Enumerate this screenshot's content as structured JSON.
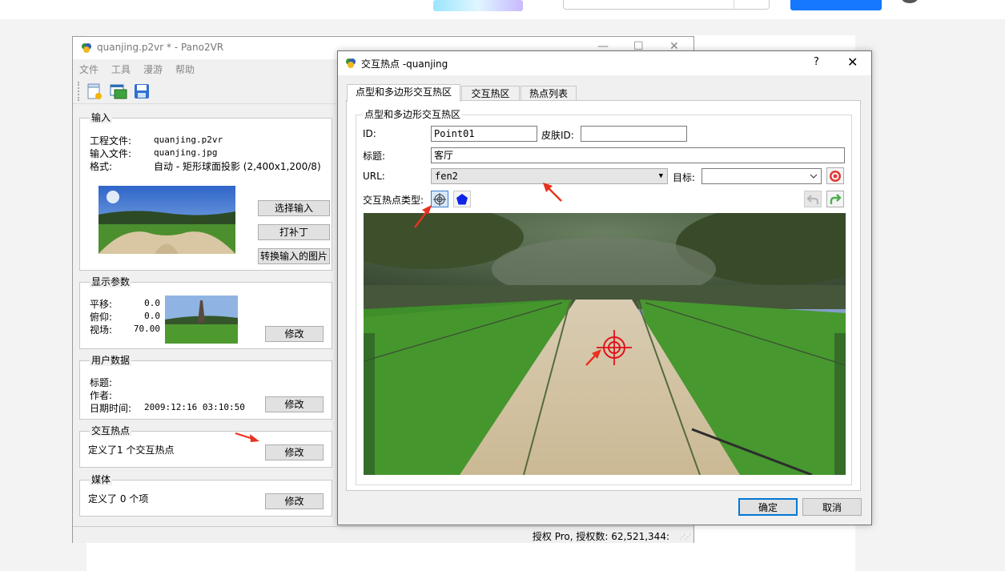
{
  "colors": {
    "accent": "#0078d7",
    "annotation_arrow": "#e8321e",
    "crosshair": "#e0111b",
    "polygon_icon": "#1024e8"
  },
  "main_window": {
    "title": "quanjing.p2vr * - Pano2VR",
    "controls": {
      "minimize": "—",
      "maximize": "☐",
      "close": "✕"
    },
    "menu": [
      "文件",
      "工具",
      "漫游",
      "帮助"
    ],
    "toolbar_icons": [
      "new-project-icon",
      "open-project-icon",
      "save-icon"
    ],
    "input": {
      "title": "输入",
      "rows": [
        {
          "label": "工程文件:",
          "value": "quanjing.p2vr"
        },
        {
          "label": "输入文件:",
          "value": "quanjing.jpg"
        },
        {
          "label": "格式:",
          "value": "自动 - 矩形球面投影 (2,400x1,200/8)"
        }
      ],
      "buttons": {
        "select": "选择输入",
        "patch": "打补丁",
        "convert": "转换输入的图片"
      }
    },
    "display": {
      "title": "显示参数",
      "rows": [
        {
          "label": "平移:",
          "value": "0.0"
        },
        {
          "label": "俯仰:",
          "value": "0.0"
        },
        {
          "label": "视场:",
          "value": "70.00"
        }
      ],
      "modify": "修改"
    },
    "user_data": {
      "title": "用户数据",
      "rows": [
        {
          "label": "标题:",
          "value": ""
        },
        {
          "label": "作者:",
          "value": ""
        },
        {
          "label": "日期时间:",
          "value": "2009:12:16 03:10:50"
        }
      ],
      "modify": "修改"
    },
    "hotspots": {
      "title": "交互热点",
      "text": "定义了1 个交互热点",
      "modify": "修改"
    },
    "media": {
      "title": "媒体",
      "text": "定义了 0 个项",
      "modify": "修改"
    },
    "status": "授权 Pro, 授权数: 62,521,344:"
  },
  "dialog": {
    "title": "交互热点 -quanjing",
    "help": "?",
    "close": "✕",
    "tabs": [
      "点型和多边形交互热区",
      "交互热区",
      "热点列表"
    ],
    "active_tab": 0,
    "group_title": "点型和多边形交互热区",
    "id_label": "ID:",
    "id_value": "Point01",
    "skin_label": "皮肤ID:",
    "skin_value": "",
    "caption_label": "标题:",
    "caption_value": "客厅",
    "url_label": "URL:",
    "url_value": "fen2",
    "target_label": "目标:",
    "target_value": "",
    "type_label": "交互热点类型:",
    "type_icons": [
      "point-hotspot-icon",
      "polygon-hotspot-icon"
    ],
    "ok": "确定",
    "cancel": "取消"
  },
  "icons": {
    "dropdown": "▼",
    "grip": "⋰⋰"
  }
}
